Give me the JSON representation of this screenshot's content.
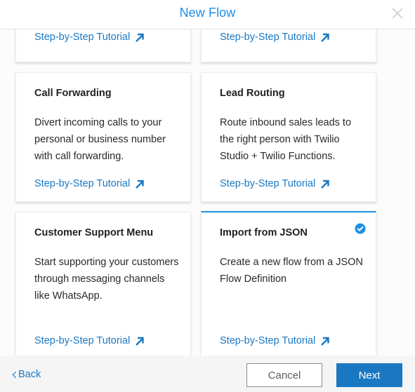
{
  "dialog": {
    "title": "New Flow",
    "close_icon": "close-icon"
  },
  "colors": {
    "accent": "#1a8fe3",
    "link": "#1a78c2",
    "primary_button": "#1a78c2"
  },
  "cards": [
    {
      "title": "",
      "description": "",
      "tutorial_label": "Step-by-Step Tutorial",
      "selected": false
    },
    {
      "title": "",
      "description": "",
      "tutorial_label": "Step-by-Step Tutorial",
      "selected": false
    },
    {
      "title": "Call Forwarding",
      "description": "Divert incoming calls to your personal or business number with call forwarding.",
      "tutorial_label": "Step-by-Step Tutorial",
      "selected": false
    },
    {
      "title": "Lead Routing",
      "description": "Route inbound sales leads to the right person with Twilio Studio + Twilio Functions.",
      "tutorial_label": "Step-by-Step Tutorial",
      "selected": false
    },
    {
      "title": "Customer Support Menu",
      "description": "Start supporting your customers through messaging channels like WhatsApp.",
      "tutorial_label": "Step-by-Step Tutorial",
      "selected": false
    },
    {
      "title": "Import from JSON",
      "description": "Create a new flow from a JSON Flow Definition",
      "tutorial_label": "Step-by-Step Tutorial",
      "selected": true
    }
  ],
  "footer": {
    "back_label": "Back",
    "cancel_label": "Cancel",
    "next_label": "Next"
  }
}
